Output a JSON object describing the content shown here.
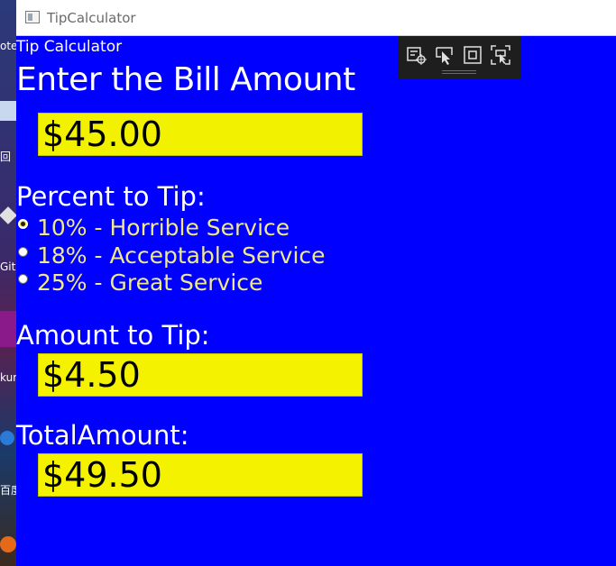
{
  "window": {
    "title": "TipCalculator"
  },
  "app": {
    "heading": "Tip Calculator"
  },
  "bill": {
    "label": "Enter the Bill Amount",
    "value": "$45.00"
  },
  "tip": {
    "label": "Percent to Tip:",
    "options": [
      {
        "label": "10% - Horrible Service",
        "selected": true
      },
      {
        "label": "18% - Acceptable Service",
        "selected": false
      },
      {
        "label": "25% - Great Service",
        "selected": false
      }
    ]
  },
  "amount_to_tip": {
    "label": "Amount to Tip:",
    "value": "$4.50"
  },
  "total": {
    "label": "TotalAmount:",
    "value": "$49.50"
  },
  "desktop": {
    "labels": [
      "ote",
      "回",
      "Git",
      "kur",
      "百度"
    ]
  },
  "debug_toolbar": {
    "icons": [
      "live-visual-tree-icon",
      "select-element-icon",
      "display-layout-adorners-icon",
      "track-focus-icon"
    ]
  },
  "colors": {
    "window_background": "#0000ff",
    "field_background": "#f2f200",
    "radio_text": "#f0e98a",
    "label_text": "#ffffff",
    "debug_toolbar": "#1e1e1e"
  }
}
